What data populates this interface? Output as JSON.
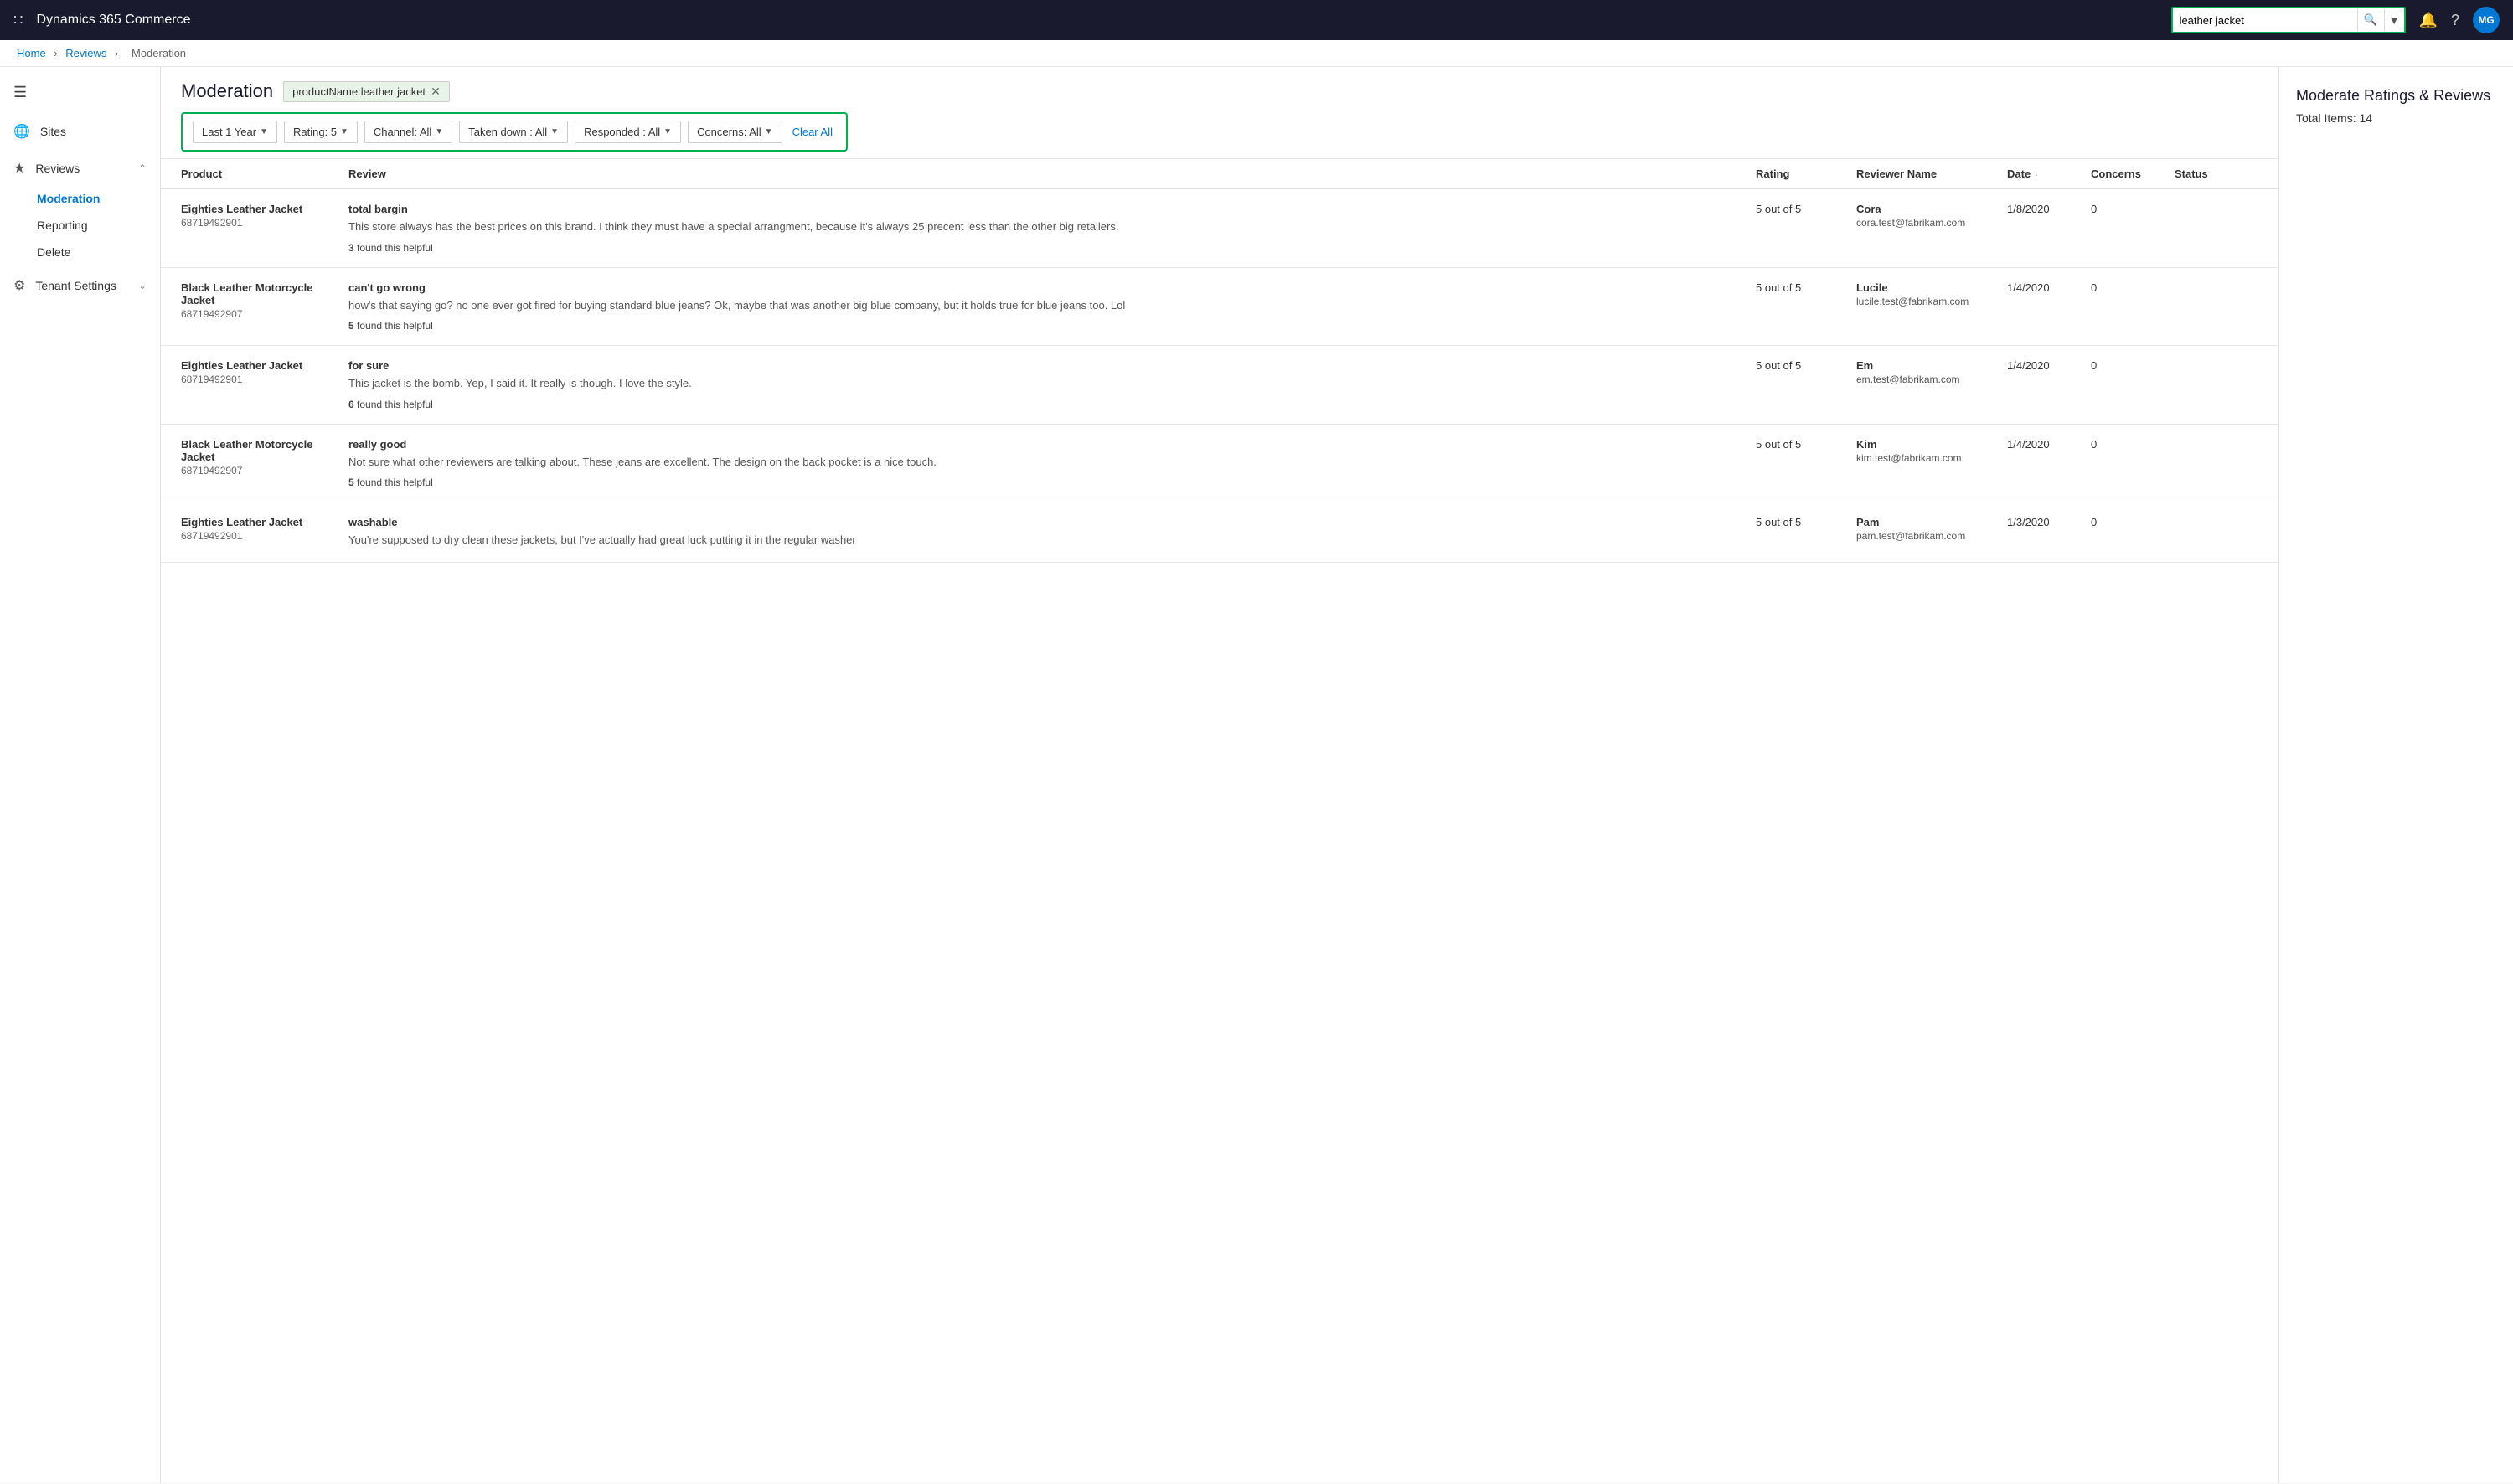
{
  "app": {
    "title": "Dynamics 365 Commerce",
    "avatar": "MG"
  },
  "search": {
    "value": "leather jacket",
    "placeholder": "leather jacket"
  },
  "breadcrumb": {
    "home": "Home",
    "reviews": "Reviews",
    "moderation": "Moderation"
  },
  "page": {
    "title": "Moderation",
    "filter_tag": "productName:leather jacket",
    "right_panel_title": "Moderate Ratings & Reviews",
    "right_panel_subtitle": "Total Items: 14"
  },
  "filters": {
    "year": "Last 1 Year",
    "rating": "Rating: 5",
    "channel": "Channel: All",
    "taken_down": "Taken down : All",
    "responded": "Responded : All",
    "concerns": "Concerns: All",
    "clear_all": "Clear All"
  },
  "sidebar": {
    "menu_sections": [
      {
        "icon": "globe",
        "label": "Sites",
        "expandable": false
      },
      {
        "icon": "star",
        "label": "Reviews",
        "expandable": true,
        "expanded": true,
        "children": [
          {
            "label": "Moderation",
            "active": true
          },
          {
            "label": "Reporting",
            "active": false
          },
          {
            "label": "Delete",
            "active": false
          }
        ]
      },
      {
        "icon": "gear",
        "label": "Tenant Settings",
        "expandable": true,
        "expanded": false
      }
    ]
  },
  "table": {
    "columns": [
      "Product",
      "Review",
      "Rating",
      "Reviewer Name",
      "Date",
      "Concerns",
      "Status"
    ],
    "rows": [
      {
        "product_name": "Eighties Leather Jacket",
        "product_id": "68719492901",
        "review_title": "total bargin",
        "review_body": "This store always has the best prices on this brand. I think they must have a special arrangment, because it's always 25 precent less than the other big retailers.",
        "helpful": "3",
        "rating": "5 out of 5",
        "reviewer_name": "Cora",
        "reviewer_email": "cora.test@fabrikam.com",
        "date": "1/8/2020",
        "concerns": "0",
        "status": ""
      },
      {
        "product_name": "Black Leather Motorcycle Jacket",
        "product_id": "68719492907",
        "review_title": "can't go wrong",
        "review_body": "how's that saying go? no one ever got fired for buying standard blue jeans? Ok, maybe that was another big blue company, but it holds true for blue jeans too. Lol",
        "helpful": "5",
        "rating": "5 out of 5",
        "reviewer_name": "Lucile",
        "reviewer_email": "lucile.test@fabrikam.com",
        "date": "1/4/2020",
        "concerns": "0",
        "status": ""
      },
      {
        "product_name": "Eighties Leather Jacket",
        "product_id": "68719492901",
        "review_title": "for sure",
        "review_body": "This jacket is the bomb. Yep, I said it. It really is though. I love the style.",
        "helpful": "6",
        "rating": "5 out of 5",
        "reviewer_name": "Em",
        "reviewer_email": "em.test@fabrikam.com",
        "date": "1/4/2020",
        "concerns": "0",
        "status": ""
      },
      {
        "product_name": "Black Leather Motorcycle Jacket",
        "product_id": "68719492907",
        "review_title": "really good",
        "review_body": "Not sure what other reviewers are talking about. These jeans are excellent. The design on the back pocket is a nice touch.",
        "helpful": "5",
        "rating": "5 out of 5",
        "reviewer_name": "Kim",
        "reviewer_email": "kim.test@fabrikam.com",
        "date": "1/4/2020",
        "concerns": "0",
        "status": ""
      },
      {
        "product_name": "Eighties Leather Jacket",
        "product_id": "68719492901",
        "review_title": "washable",
        "review_body": "You're supposed to dry clean these jackets, but I've actually had great luck putting it in the regular washer",
        "helpful": "",
        "rating": "5 out of 5",
        "reviewer_name": "Pam",
        "reviewer_email": "pam.test@fabrikam.com",
        "date": "1/3/2020",
        "concerns": "0",
        "status": ""
      }
    ]
  }
}
